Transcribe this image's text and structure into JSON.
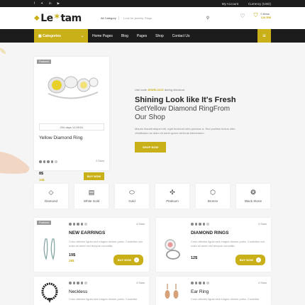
{
  "topbar": {
    "social": [
      "f",
      "✦",
      "in",
      "▶"
    ],
    "account": "My Account",
    "currency": "Currency (USD)"
  },
  "header": {
    "logo_pre": "Le",
    "logo_post": "tam",
    "search_category": "All Category",
    "search_placeholder": "Look for jewelry, Rings",
    "cart_items": "0 items",
    "cart_price": "120.50$"
  },
  "nav": {
    "categories_label": "Categories",
    "menu": [
      "Home Pages",
      "Blog",
      "Pages",
      "Shop",
      "Contact Us"
    ]
  },
  "hero": {
    "badge": "Featured",
    "countdown": "204 days 12:09:51",
    "product_name": "Yellow Diamond Ring",
    "rating_label": "4 Stars",
    "rating": 4,
    "price_new": "8$",
    "price_old": "14$",
    "buy_label": "BUY NOW",
    "code_pre": "Use code",
    "code": "JEWEL2222",
    "code_post": "during checkout",
    "headline": "Shining Look like It's Fresh",
    "subline1": "GetYellow Diamond RingFrom",
    "subline2": "Our Shop",
    "description1": "Mauris blandit aliquet elit, eget tincidunt nibh pulvinar a. Sed porttitor lectus nibh.",
    "description2": "Vestibulum ac diam sit amet quam vehicula elementum.",
    "cta": "SHOP NOW"
  },
  "categories": [
    {
      "label": "Diamond",
      "icon": "diamond-icon",
      "glyph": "◇"
    },
    {
      "label": "White Gold",
      "icon": "gold-bars-icon",
      "glyph": "▤"
    },
    {
      "label": "Gold",
      "icon": "gold-ingot-icon",
      "glyph": "⬭"
    },
    {
      "label": "Platinum",
      "icon": "platinum-icon",
      "glyph": "✣"
    },
    {
      "label": "Bronze",
      "icon": "bronze-icon",
      "glyph": "⬡"
    },
    {
      "label": "Black Stone",
      "icon": "black-stone-icon",
      "glyph": "❂"
    }
  ],
  "products": [
    {
      "badge": "Featured",
      "name": "NEW EARRINGS",
      "rating_label": "4 Stars",
      "rating": 4,
      "desc": "Cras ultricies ligula sed magna dictum porta. Curabitur non nulla sit amet nisl tempus convallis.",
      "price_new": "19$",
      "price_old": "28$",
      "buy": "BUY NOW"
    },
    {
      "badge": "",
      "name": "DIAMOND RINGS",
      "rating_label": "4 Stars",
      "rating": 4,
      "desc": "Cras ultricies ligula sed magna dictum porta. Curabitur non nulla sit amet nisl tempus convallis.",
      "price_new": "12$",
      "price_old": "",
      "buy": "BUY NOW"
    },
    {
      "badge": "",
      "name": "Neckless",
      "rating_label": "4 Stars",
      "rating": 4,
      "desc": "Cras ultricies ligula sed magna dictum porta. Curabitur",
      "price_new": "",
      "price_old": "",
      "buy": ""
    },
    {
      "badge": "",
      "name": "Ear Ring",
      "rating_label": "4 Stars",
      "rating": 4,
      "desc": "Cras ultricies ligula sed magna dictum porta. Curabitur",
      "price_new": "",
      "price_old": "",
      "buy": ""
    }
  ],
  "colors": {
    "accent": "#c9b018",
    "dark": "#1c1c1c"
  }
}
